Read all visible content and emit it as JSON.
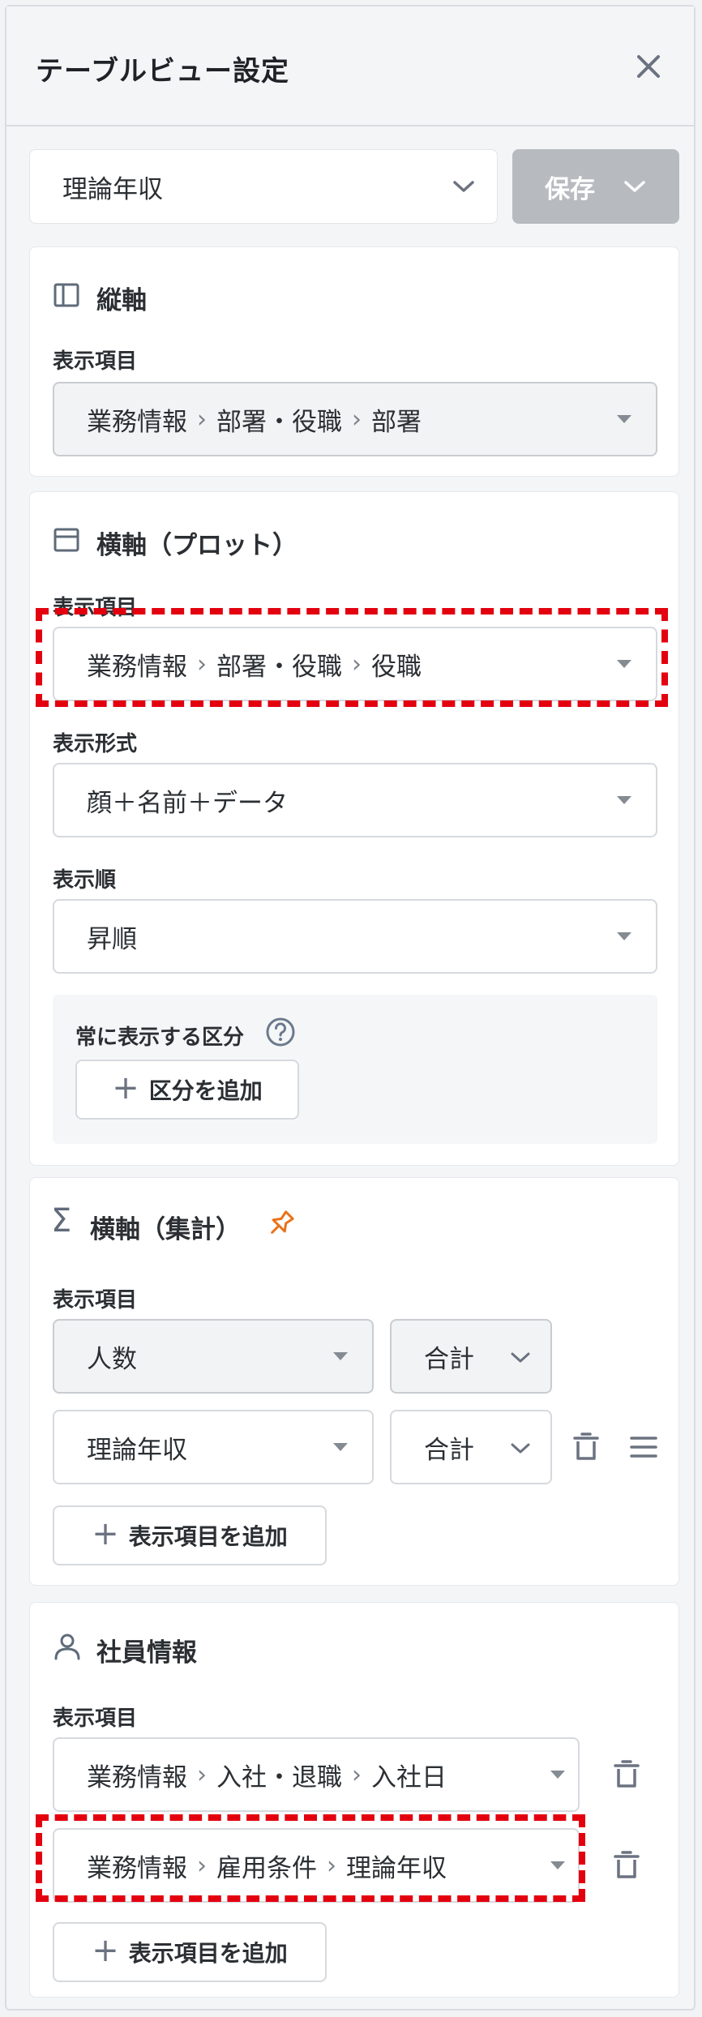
{
  "header": {
    "title": "テーブルビュー設定"
  },
  "preset": {
    "value": "理論年収",
    "save_label": "保存"
  },
  "vertical_axis": {
    "title": "縦軸",
    "display_item_label": "表示項目",
    "display_item_path": [
      "業務情報",
      "部署・役職",
      "部署"
    ]
  },
  "horizontal_plot": {
    "title": "横軸（プロット）",
    "display_item_label": "表示項目",
    "display_item_path": [
      "業務情報",
      "部署・役職",
      "役職"
    ],
    "display_format_label": "表示形式",
    "display_format_value": "顔＋名前＋データ",
    "display_order_label": "表示順",
    "display_order_value": "昇順",
    "always_show_label": "常に表示する区分",
    "add_category_label": "区分を追加"
  },
  "horizontal_aggregate": {
    "title": "横軸（集計）",
    "display_item_label": "表示項目",
    "rows": [
      {
        "item": "人数",
        "agg": "合計"
      },
      {
        "item": "理論年収",
        "agg": "合計"
      }
    ],
    "add_item_label": "表示項目を追加"
  },
  "employee_info": {
    "title": "社員情報",
    "display_item_label": "表示項目",
    "rows": [
      {
        "path": [
          "業務情報",
          "入社・退職",
          "入社日"
        ]
      },
      {
        "path": [
          "業務情報",
          "雇用条件",
          "理論年収"
        ]
      }
    ],
    "add_item_label": "表示項目を追加"
  },
  "colors": {
    "accent_red": "#e3000f",
    "pin_orange": "#e8731b",
    "save_gray": "#b7bbc0"
  }
}
